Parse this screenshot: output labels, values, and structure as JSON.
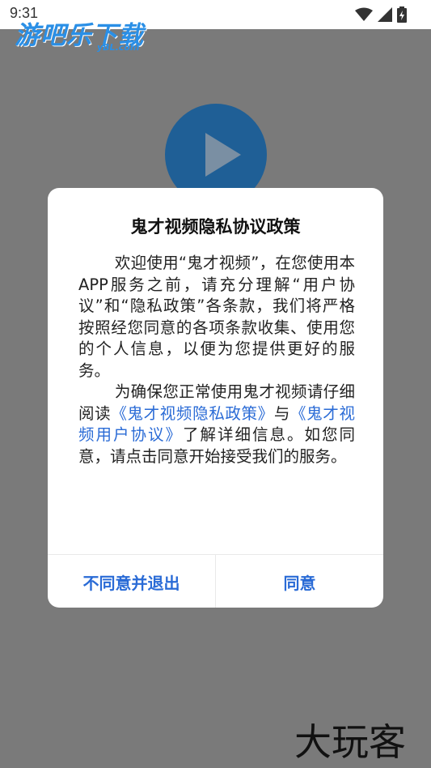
{
  "status_bar": {
    "time": "9:31"
  },
  "watermark": {
    "text": "游吧乐下载",
    "sub": "yBL.com"
  },
  "dialog": {
    "title": "鬼才视频隐私协议政策",
    "para1": "欢迎使用“鬼才视频”，在您使用本APP服务之前，请充分理解“用户协议”和“隐私政策”各条款，我们将严格按照经您同意的各项条款收集、使用您的个人信息，以便为您提供更好的服务。",
    "para2_prefix": "为确保您正常使用鬼才视频请仔细阅读",
    "privacy_link": "《鬼才视频隐私政策》",
    "para2_mid": "与",
    "agreement_link": "《鬼才视频用户协议》",
    "para2_suffix": "了解详细信息。如您同意，请点击同意开始接受我们的服务。",
    "decline_label": "不同意并退出",
    "accept_label": "同意"
  },
  "brand_mark": "大玩客",
  "colors": {
    "accent": "#2a6bd6",
    "overlay": "#7a7a7a",
    "play_button": "#1f5f96"
  }
}
